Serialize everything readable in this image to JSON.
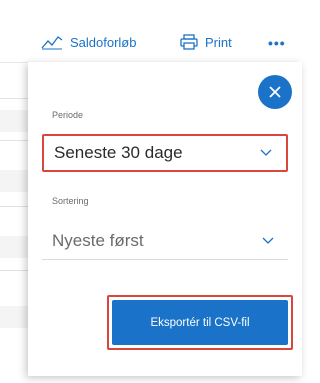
{
  "toolbar": {
    "saldo_label": "Saldoforløb",
    "print_label": "Print",
    "more_label": "•••"
  },
  "panel": {
    "periode_label": "Periode",
    "periode_value": "Seneste 30 dage",
    "sortering_label": "Sortering",
    "sortering_value": "Nyeste først",
    "export_label": "Eksportér til CSV-fil"
  },
  "colors": {
    "accent": "#1a73c8",
    "highlight": "#d9463c"
  },
  "icons": [
    "line-chart-icon",
    "printer-icon",
    "more-icon",
    "close-icon",
    "chevron-down-icon"
  ]
}
